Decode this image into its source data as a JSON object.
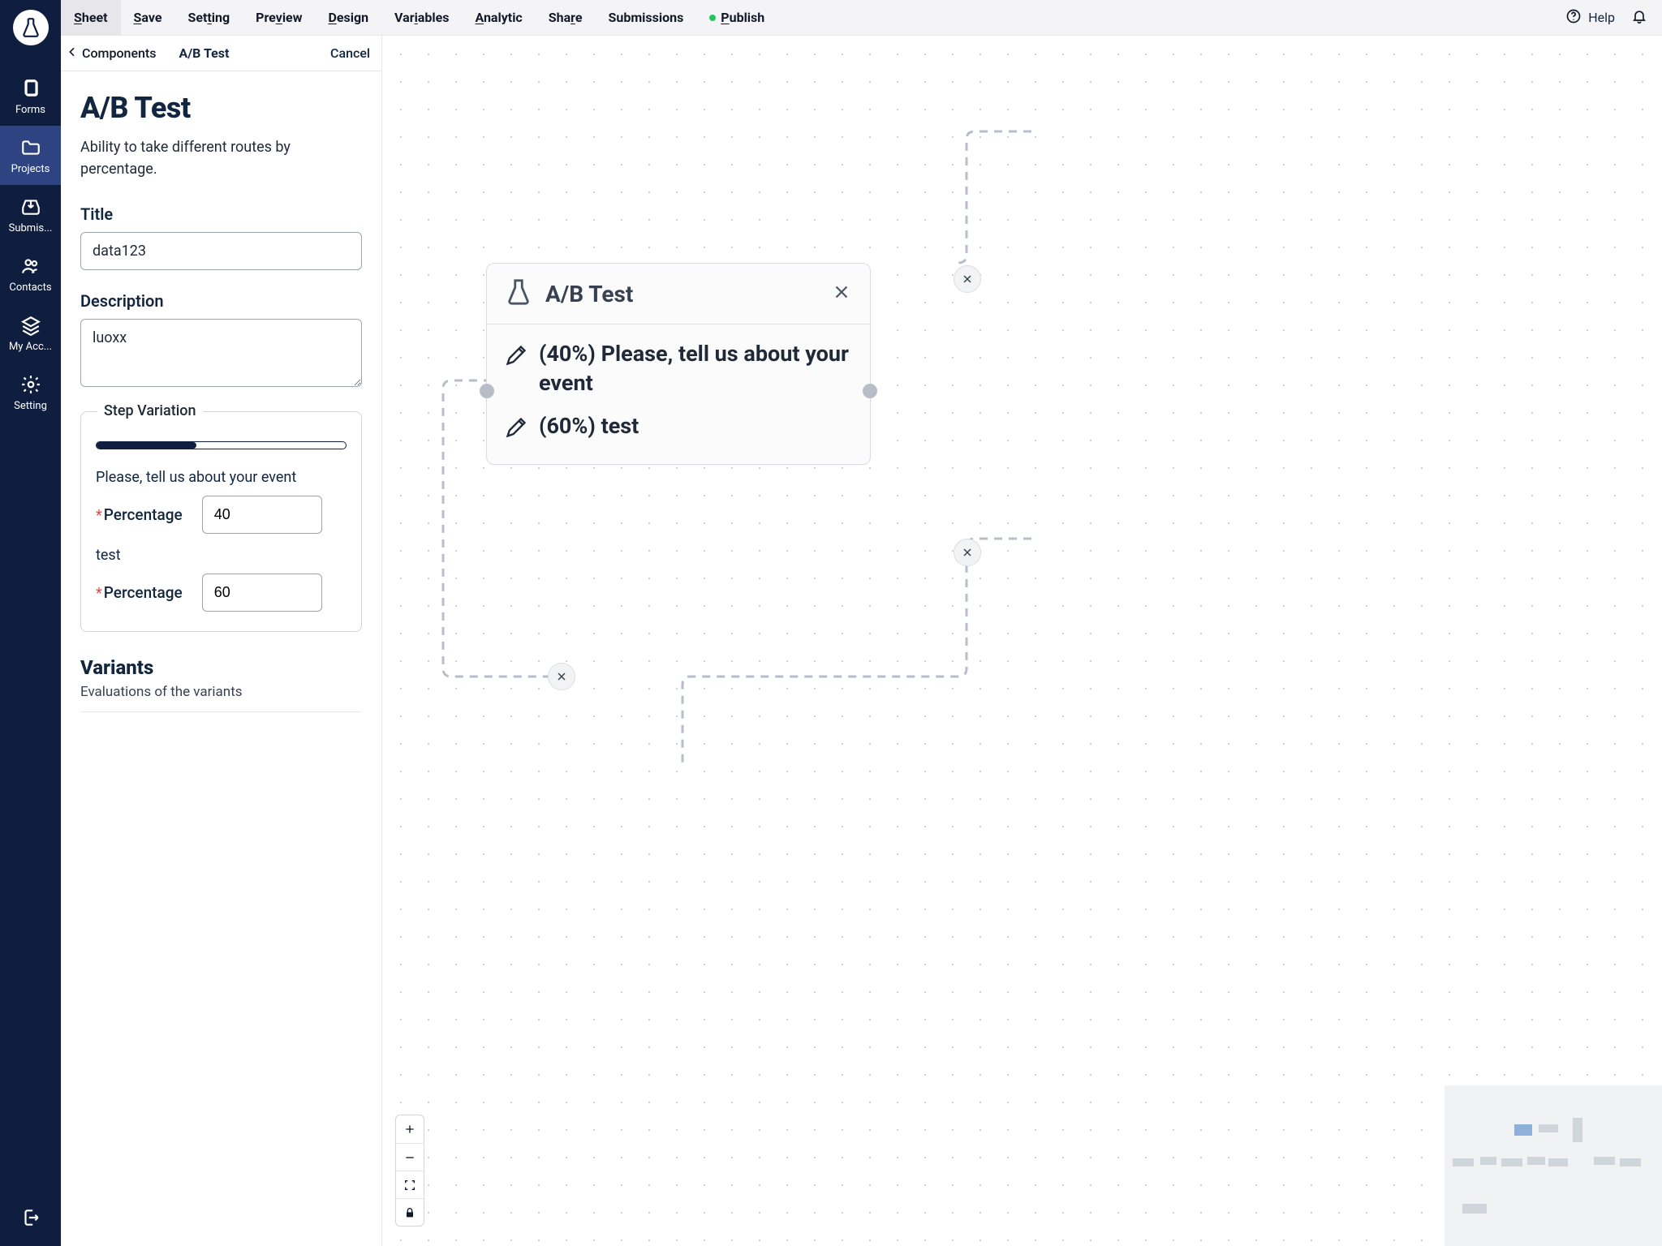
{
  "topbar": {
    "menu": [
      {
        "label": "Sheet",
        "ul": "S",
        "rest": "heet",
        "active": true
      },
      {
        "label": "Save",
        "ul": "S",
        "rest": "ave"
      },
      {
        "label": "Setting",
        "ul": "t",
        "pre": "Set",
        "rest": "ing"
      },
      {
        "label": "Preview",
        "ul": "v",
        "pre": "Pre",
        "rest": "iew"
      },
      {
        "label": "Design",
        "ul": "D",
        "rest": "esign"
      },
      {
        "label": "Variables",
        "ul": "i",
        "pre": "Var",
        "rest": "ables"
      },
      {
        "label": "Analytic",
        "ul": "A",
        "rest": "nalytic"
      },
      {
        "label": "Share",
        "ul": "r",
        "pre": "Sha",
        "rest": "e"
      },
      {
        "label": "Submissions"
      },
      {
        "label": "Publish",
        "ul": "P",
        "rest": "ublish",
        "dot": true
      }
    ],
    "help": "Help"
  },
  "sidebar": {
    "items": [
      {
        "label": "Forms"
      },
      {
        "label": "Projects"
      },
      {
        "label": "Submis..."
      },
      {
        "label": "Contacts"
      },
      {
        "label": "My Acc..."
      },
      {
        "label": "Setting"
      }
    ]
  },
  "panel": {
    "back": "Components",
    "crumb_title": "A/B Test",
    "cancel": "Cancel",
    "heading": "A/B Test",
    "description": "Ability to take different routes by percentage.",
    "title_label": "Title",
    "title_value": "data123",
    "desc_label": "Description",
    "desc_value": "luoxx",
    "step_variation_label": "Step Variation",
    "slider_fill_pct": 40,
    "variants": [
      {
        "name": "Please, tell us about your event",
        "pct_label": "Percentage",
        "pct_value": "40"
      },
      {
        "name": "test",
        "pct_label": "Percentage",
        "pct_value": "60"
      }
    ],
    "variants_heading": "Variants",
    "variants_sub": "Evaluations of the variants"
  },
  "canvas": {
    "card_title": "A/B Test",
    "rows": [
      "(40%) Please, tell us about your event",
      "(60%) test"
    ]
  }
}
